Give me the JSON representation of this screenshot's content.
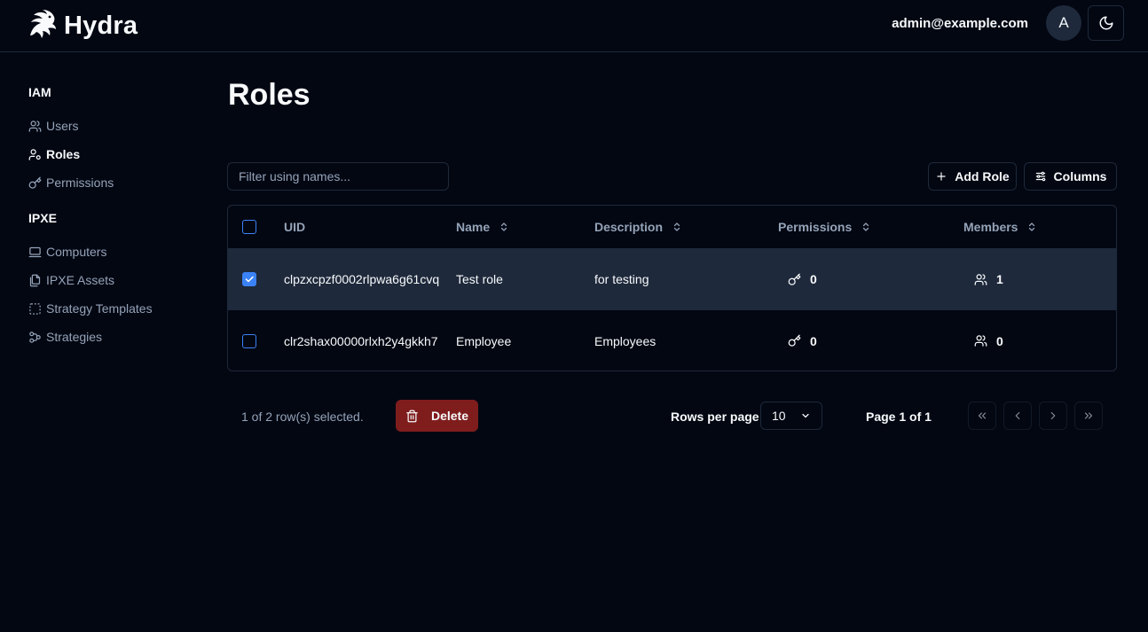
{
  "app": {
    "name": "Hydra"
  },
  "header": {
    "user_email": "admin@example.com",
    "avatar_initial": "A"
  },
  "sidebar": {
    "groups": [
      {
        "title": "IAM",
        "items": [
          {
            "label": "Users",
            "icon": "users-icon"
          },
          {
            "label": "Roles",
            "icon": "user-cog-icon",
            "active": true
          },
          {
            "label": "Permissions",
            "icon": "key-icon"
          }
        ]
      },
      {
        "title": "IPXE",
        "items": [
          {
            "label": "Computers",
            "icon": "laptop-icon"
          },
          {
            "label": "IPXE Assets",
            "icon": "files-icon"
          },
          {
            "label": "Strategy Templates",
            "icon": "dashed-square-icon"
          },
          {
            "label": "Strategies",
            "icon": "workflow-icon"
          }
        ]
      }
    ]
  },
  "page": {
    "title": "Roles"
  },
  "toolbar": {
    "filter_placeholder": "Filter using names...",
    "add_role_label": "Add Role",
    "columns_label": "Columns"
  },
  "table": {
    "columns": [
      "UID",
      "Name",
      "Description",
      "Permissions",
      "Members"
    ],
    "rows": [
      {
        "selected": true,
        "uid": "clpzxcpzf0002rlpwa6g61cvq",
        "name": "Test role",
        "description": "for testing",
        "permissions": "0",
        "members": "1"
      },
      {
        "selected": false,
        "uid": "clr2shax00000rlxh2y4gkkh7",
        "name": "Employee",
        "description": "Employees",
        "permissions": "0",
        "members": "0"
      }
    ]
  },
  "footer": {
    "selection_text": "1 of 2 row(s) selected.",
    "delete_label": "Delete",
    "rows_per_page_label": "Rows per page",
    "rows_per_page_value": "10",
    "page_info": "Page 1 of 1"
  },
  "colors": {
    "background": "#030712",
    "border": "#1e293b",
    "accent": "#3b82f6",
    "danger": "#7f1d1d",
    "muted_text": "#94a3b8"
  }
}
